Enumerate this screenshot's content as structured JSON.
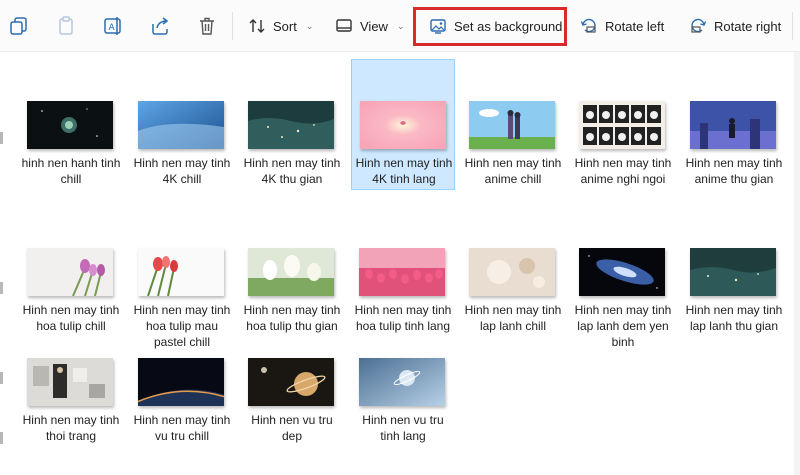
{
  "toolbar": {
    "sort_label": "Sort",
    "view_label": "View",
    "set_background_label": "Set as background",
    "rotate_left_label": "Rotate left",
    "rotate_right_label": "Rotate right"
  },
  "files": [
    {
      "name": "hinh nen hanh tinh chill"
    },
    {
      "name": "Hinh nen may tinh 4K chill"
    },
    {
      "name": "Hinh nen may tinh 4K thu gian"
    },
    {
      "name": "Hinh nen may tinh 4K tinh lang",
      "selected": true
    },
    {
      "name": "Hinh nen may tinh anime chill"
    },
    {
      "name": "Hinh nen may tinh anime nghi ngoi"
    },
    {
      "name": "Hinh nen may tinh anime thu gian"
    },
    {
      "name": "Hinh nen may tinh hoa tulip chill"
    },
    {
      "name": "Hinh nen may tinh hoa tulip mau pastel chill"
    },
    {
      "name": "Hinh nen may tinh hoa tulip thu gian"
    },
    {
      "name": "Hinh nen may tinh hoa tulip tinh lang"
    },
    {
      "name": "Hinh nen may tinh lap lanh chill"
    },
    {
      "name": "Hinh nen may tinh lap lanh dem yen binh"
    },
    {
      "name": "Hinh nen may tinh lap lanh thu gian"
    },
    {
      "name": "Hinh nen may tinh thoi trang"
    },
    {
      "name": "Hinh nen may tinh vu tru chill"
    },
    {
      "name": "Hinh nen vu tru dep"
    },
    {
      "name": "Hinh nen vu tru tinh lang"
    }
  ],
  "colors": {
    "selection": "#cde8ff",
    "highlight_box": "#d92b2b"
  }
}
